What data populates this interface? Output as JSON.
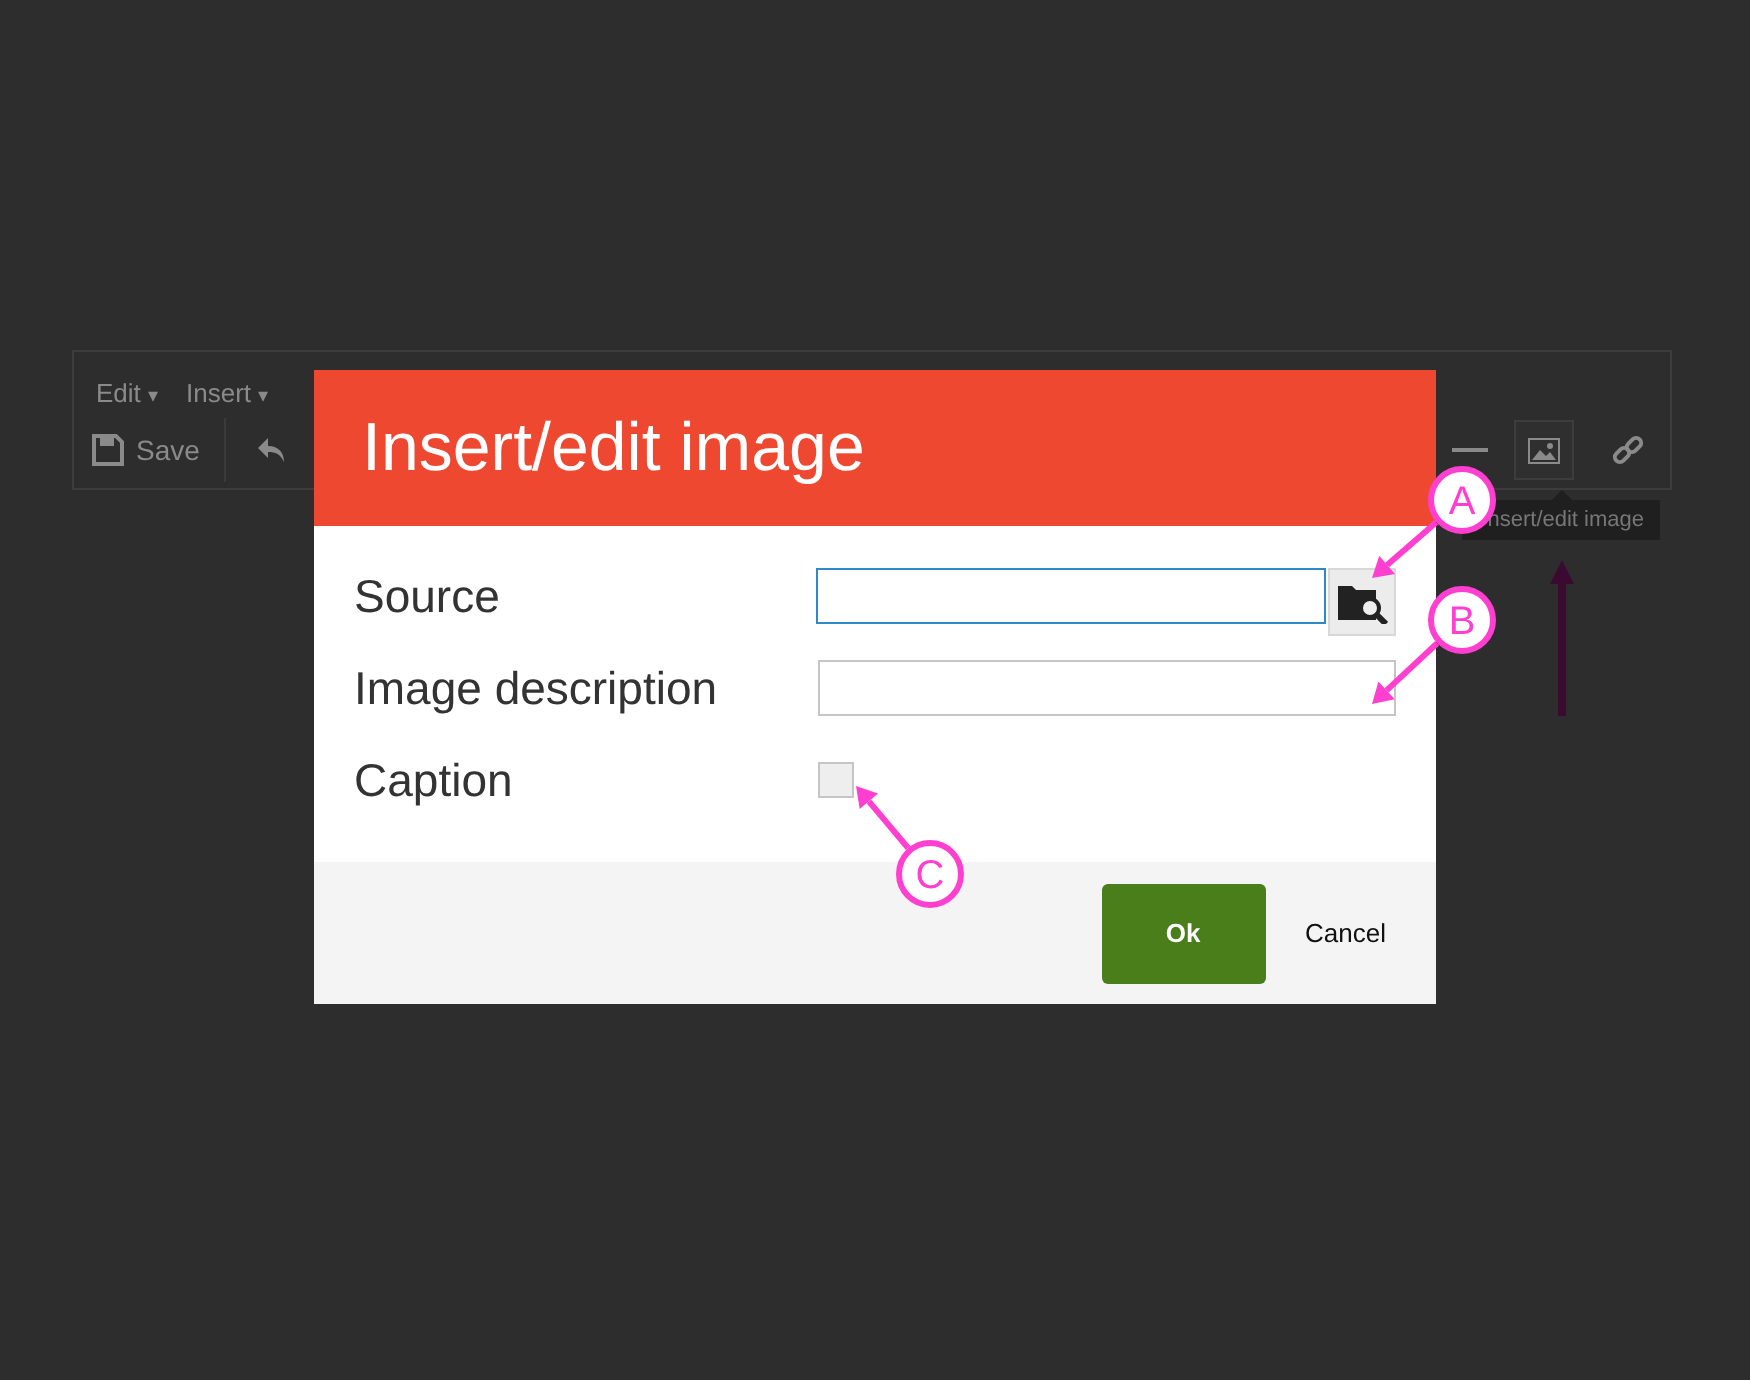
{
  "editor": {
    "menus": [
      {
        "label": "Edit",
        "caret": "▾"
      },
      {
        "label": "Insert",
        "caret": "▾"
      }
    ],
    "save_button": {
      "label": "Save"
    },
    "tooltip": "nsert/edit image",
    "image_button": {
      "selected": true
    }
  },
  "dialog": {
    "title": "Insert/edit image",
    "fields": [
      {
        "kind": "text",
        "label": "Source",
        "focused": true,
        "browse": true
      },
      {
        "kind": "text",
        "label": "Image description",
        "focused": false,
        "browse": false
      },
      {
        "kind": "checkbox",
        "label": "Caption",
        "checked": false
      }
    ],
    "buttons": [
      {
        "label": "Ok",
        "primary": true
      },
      {
        "label": "Cancel",
        "primary": false
      }
    ]
  },
  "callouts": [
    {
      "letter": "A"
    },
    {
      "letter": "B"
    },
    {
      "letter": "C"
    }
  ]
}
